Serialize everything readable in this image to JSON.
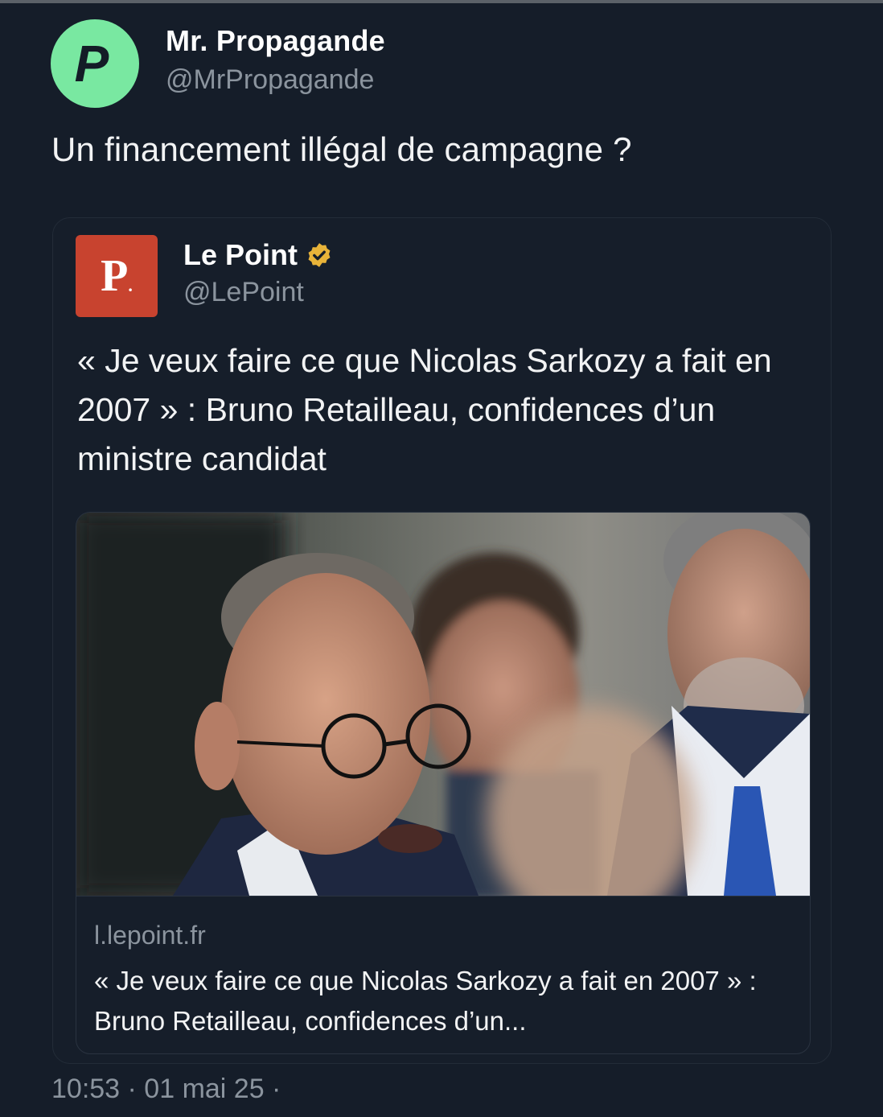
{
  "tweet": {
    "author": {
      "display_name": "Mr. Propagande",
      "handle": "@MrPropagande",
      "avatar_letter": "P",
      "avatar_color": "#79e8a1"
    },
    "text": "Un financement illégal de campagne ?",
    "timestamp": "10:53 · 01 mai 25 ·"
  },
  "quoted_tweet": {
    "author": {
      "display_name": "Le Point",
      "handle": "@LePoint",
      "avatar_letter": "P",
      "avatar_dot": ".",
      "avatar_color": "#c8432f",
      "verified": true,
      "verified_color": "#e8b339"
    },
    "text": "« Je veux faire ce que Nicolas Sarkozy a fait en 2007 » : Bruno Retailleau, confidences d’un ministre candidat",
    "link_card": {
      "domain": "l.lepoint.fr",
      "title": "« Je veux faire ce que Nicolas Sarkozy a fait en 2007 » : Bruno Retailleau, confidences d’un..."
    }
  }
}
